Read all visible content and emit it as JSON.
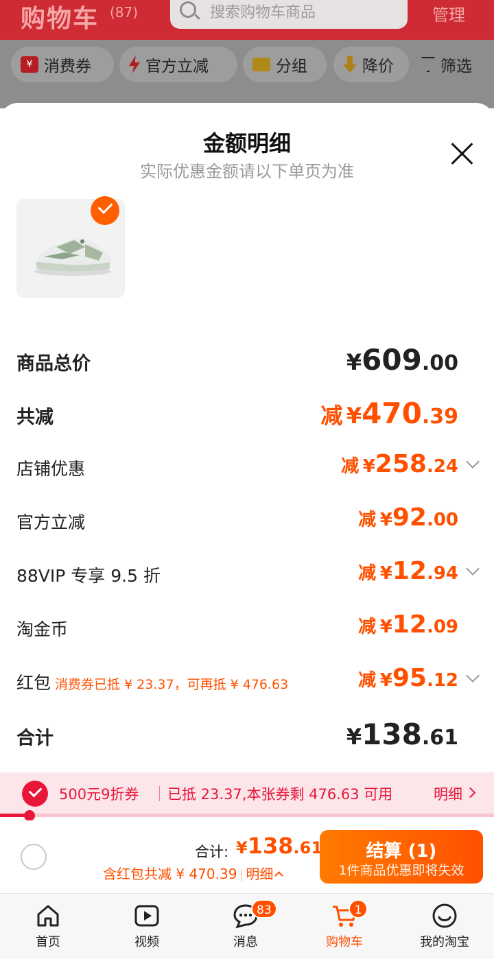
{
  "background_page": {
    "title": "购物车",
    "count": "(87)",
    "search_placeholder": "搜索购物车商品",
    "manage": "管理",
    "filters": [
      {
        "label": "消费券",
        "icon": "coupon-icon"
      },
      {
        "label": "官方立减",
        "icon": "bolt-icon"
      },
      {
        "label": "分组",
        "icon": "folder-icon"
      },
      {
        "label": "降价",
        "icon": "price-down-icon"
      },
      {
        "label": "筛选",
        "icon": "funnel-icon"
      }
    ]
  },
  "sheet": {
    "title": "金额明细",
    "subtitle": "实际优惠金额请以下单页为准",
    "rows": [
      {
        "label": "商品总价",
        "prefix": "",
        "yen": "¥",
        "int": "609",
        "dec": ".00"
      },
      {
        "label": "共减",
        "prefix": "减",
        "yen": "¥",
        "int": "470",
        "dec": ".39"
      },
      {
        "label": "店铺优惠",
        "prefix": "减",
        "yen": "¥",
        "int": "258",
        "dec": ".24"
      },
      {
        "label": "官方立减",
        "prefix": "减",
        "yen": "¥",
        "int": "92",
        "dec": ".00"
      },
      {
        "label": "88VIP 专享 9.5 折",
        "prefix": "减",
        "yen": "¥",
        "int": "12",
        "dec": ".94"
      },
      {
        "label": "淘金币",
        "prefix": "减",
        "yen": "¥",
        "int": "12",
        "dec": ".09"
      },
      {
        "label": "红包",
        "note": "消费券已抵 ¥ 23.37，可再抵 ¥ 476.63",
        "prefix": "减",
        "yen": "¥",
        "int": "95",
        "dec": ".12"
      },
      {
        "label": "合计",
        "prefix": "",
        "yen": "¥",
        "int": "138",
        "dec": ".61"
      }
    ]
  },
  "coupon_strip": {
    "name": "500元9折券",
    "info": "已抵 23.37,本张券剩 476.63 可用",
    "detail": "明细",
    "progress": 0.06
  },
  "checkout": {
    "total_label": "合计:",
    "yen": "¥",
    "int": "138",
    "dec": ".61",
    "sub_text": "含红包共减 ¥ 470.39",
    "sub_detail": "明细",
    "button_main": "结算 (1)",
    "button_sub": "1件商品优惠即将失效"
  },
  "tabbar": {
    "tabs": [
      {
        "label": "首页",
        "icon": "home-icon"
      },
      {
        "label": "视频",
        "icon": "video-icon"
      },
      {
        "label": "消息",
        "icon": "message-icon",
        "badge": "83"
      },
      {
        "label": "购物车",
        "icon": "cart-icon",
        "badge": "1"
      },
      {
        "label": "我的淘宝",
        "icon": "profile-icon"
      }
    ]
  },
  "colors": {
    "accent": "#ff5000",
    "brand_red": "#e8173a",
    "topbar": "#cf2b34"
  }
}
